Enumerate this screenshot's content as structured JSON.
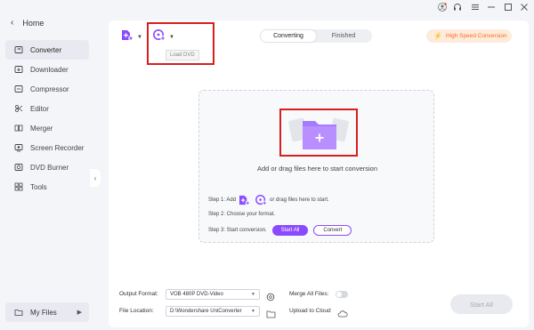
{
  "sidebar": {
    "home": "Home",
    "items": [
      {
        "label": "Converter",
        "icon": "converter-icon"
      },
      {
        "label": "Downloader",
        "icon": "downloader-icon"
      },
      {
        "label": "Compressor",
        "icon": "compressor-icon"
      },
      {
        "label": "Editor",
        "icon": "editor-icon"
      },
      {
        "label": "Merger",
        "icon": "merger-icon"
      },
      {
        "label": "Screen Recorder",
        "icon": "screen-recorder-icon"
      },
      {
        "label": "DVD Burner",
        "icon": "dvd-burner-icon"
      },
      {
        "label": "Tools",
        "icon": "tools-icon"
      }
    ],
    "my_files": "My Files"
  },
  "toolbar": {
    "tooltip": "Load DVD",
    "tabs": [
      "Converting",
      "Finished"
    ],
    "high_speed": "High Speed Conversion"
  },
  "drop": {
    "text": "Add or drag files here to start conversion",
    "step1_a": "Step 1: Add",
    "step1_b": "or drag files here to start.",
    "step2": "Step 2: Choose your format.",
    "step3": "Step 3: Start conversion.",
    "start_all": "Start All",
    "convert": "Convert"
  },
  "bottom": {
    "output_format_label": "Output Format:",
    "output_format_value": "VOB 480P DVD-Video",
    "merge_label": "Merge All Files:",
    "file_location_label": "File Location:",
    "file_location_value": "D:\\Wondershare UniConverter",
    "upload_label": "Upload to Cloud",
    "start_all": "Start All"
  },
  "colors": {
    "accent": "#8a4bff",
    "highlight_box": "#d81e1e",
    "speed": "#ff6a1f"
  }
}
